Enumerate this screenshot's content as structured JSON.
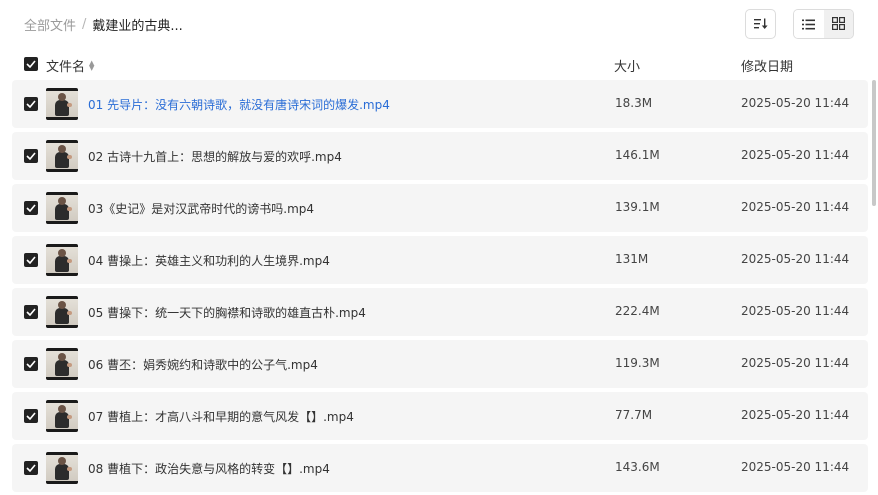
{
  "breadcrumb": {
    "root": "全部文件",
    "separator": "/",
    "current": "戴建业的古典..."
  },
  "toolbar": {
    "sort_icon": "sort-icon",
    "list_view_icon": "list-view-icon",
    "grid_view_icon": "grid-view-icon",
    "active_view": "list"
  },
  "columns": {
    "name": "文件名",
    "size": "大小",
    "date": "修改日期"
  },
  "colors": {
    "link": "#2a6dd6",
    "row_bg": "#f5f5f5",
    "checkbox": "#222222"
  },
  "files": [
    {
      "name": "01 先导片：没有六朝诗歌，就没有唐诗宋词的爆发.mp4",
      "size": "18.3M",
      "date": "2025-05-20 11:44",
      "highlighted": true
    },
    {
      "name": "02 古诗十九首上：思想的解放与爱的欢呼.mp4",
      "size": "146.1M",
      "date": "2025-05-20 11:44"
    },
    {
      "name": "03《史记》是对汉武帝时代的谤书吗.mp4",
      "size": "139.1M",
      "date": "2025-05-20 11:44"
    },
    {
      "name": "04 曹操上：英雄主义和功利的人生境界.mp4",
      "size": "131M",
      "date": "2025-05-20 11:44"
    },
    {
      "name": "05 曹操下：统一天下的胸襟和诗歌的雄直古朴.mp4",
      "size": "222.4M",
      "date": "2025-05-20 11:44"
    },
    {
      "name": "06 曹丕：娟秀婉约和诗歌中的公子气.mp4",
      "size": "119.3M",
      "date": "2025-05-20 11:44"
    },
    {
      "name": "07 曹植上：才高八斗和早期的意气风发【】.mp4",
      "size": "77.7M",
      "date": "2025-05-20 11:44"
    },
    {
      "name": "08 曹植下：政治失意与风格的转变【】.mp4",
      "size": "143.6M",
      "date": "2025-05-20 11:44"
    }
  ]
}
